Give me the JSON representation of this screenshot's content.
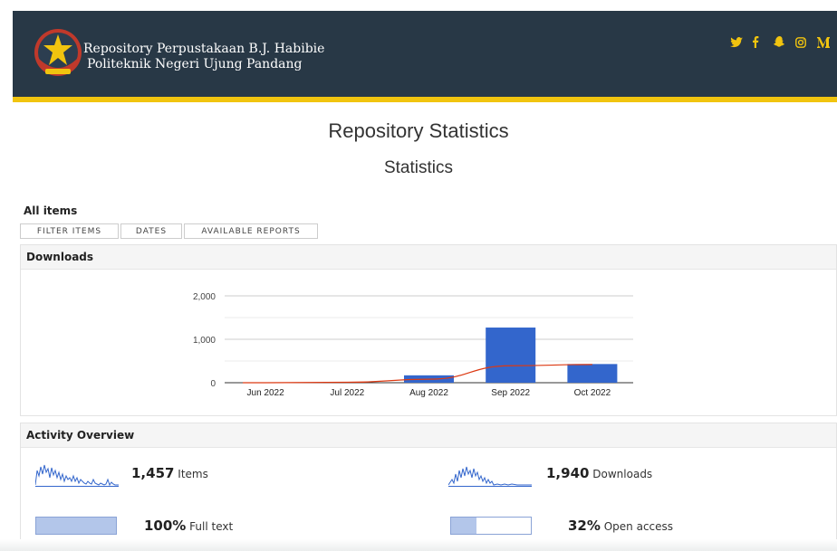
{
  "header": {
    "title_line1": "Repository Perpustakaan B.J. Habibie",
    "title_line2": "Politeknik Negeri Ujung Pandang",
    "social_icons": [
      "twitter-icon",
      "facebook-icon",
      "snapchat-icon",
      "instagram-icon",
      "medium-icon"
    ],
    "colors": {
      "background": "#283846",
      "accent": "#f1c40f"
    }
  },
  "page": {
    "title": "Repository Statistics",
    "subtitle": "Statistics"
  },
  "filters": {
    "heading": "All items",
    "tabs": [
      "FILTER ITEMS",
      "DATES",
      "AVAILABLE REPORTS"
    ]
  },
  "downloads_panel": {
    "heading": "Downloads"
  },
  "chart_data": {
    "type": "bar",
    "categories": [
      "Jun 2022",
      "Jul 2022",
      "Aug 2022",
      "Sep 2022",
      "Oct 2022"
    ],
    "values": [
      0,
      0,
      170,
      1270,
      430
    ],
    "trend_line": [
      0,
      10,
      80,
      390,
      420
    ],
    "y_ticks": [
      "0",
      "1,000",
      "2,000"
    ],
    "ylim": [
      0,
      2000
    ],
    "grid": true,
    "colors": {
      "bar": "#3366cc",
      "trend": "#dc3912"
    }
  },
  "activity": {
    "heading": "Activity Overview",
    "items_count": "1,457",
    "items_label": "Items",
    "downloads_count": "1,940",
    "downloads_label": "Downloads",
    "fulltext_pct": "100%",
    "fulltext_label": "Full text",
    "fulltext_fraction": 1.0,
    "openaccess_pct": "32%",
    "openaccess_label": "Open access",
    "openaccess_fraction": 0.32
  }
}
